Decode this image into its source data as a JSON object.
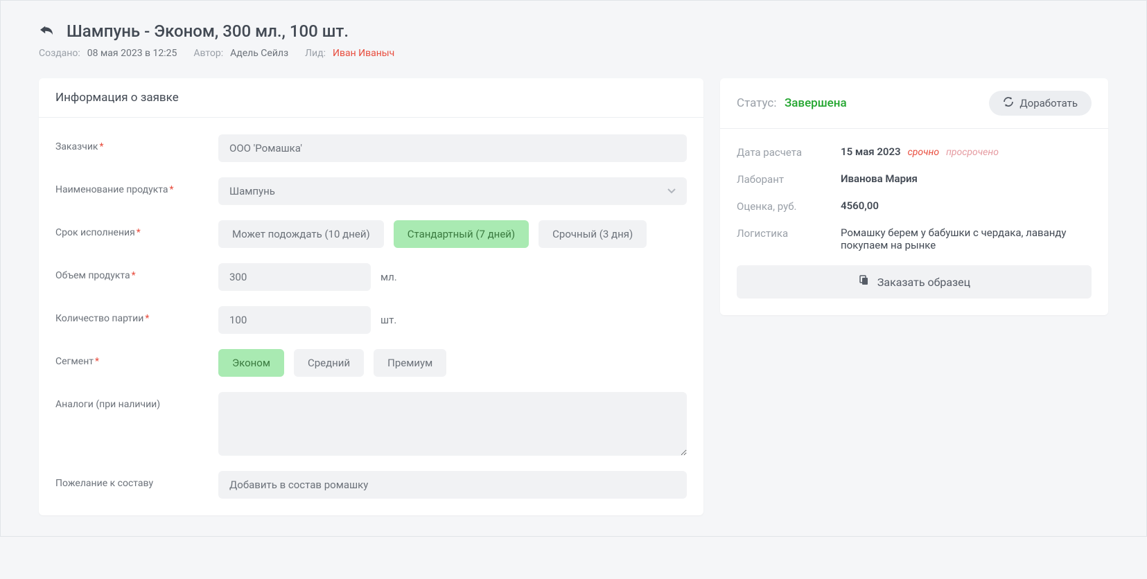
{
  "header": {
    "title": "Шампунь - Эконом, 300 мл., 100 шт.",
    "created_label": "Создано:",
    "created_value": "08 мая 2023 в 12:25",
    "author_label": "Автор:",
    "author_value": "Адель Сейлз",
    "lead_label": "Лид:",
    "lead_value": "Иван Иваныч"
  },
  "form_card": {
    "title": "Информация о заявке",
    "customer_label": "Заказчик",
    "customer_value": "ООО 'Ромашка'",
    "product_label": "Наименование продукта",
    "product_value": "Шампунь",
    "deadline_label": "Срок исполнения",
    "deadline_opts": {
      "wait": "Может подождать (10 дней)",
      "standard": "Стандартный (7 дней)",
      "urgent": "Срочный (3 дня)"
    },
    "volume_label": "Объем продукта",
    "volume_value": "300",
    "volume_unit": "мл.",
    "qty_label": "Количество партии",
    "qty_value": "100",
    "qty_unit": "шт.",
    "segment_label": "Сегмент",
    "segment_opts": {
      "econom": "Эконом",
      "mid": "Средний",
      "premium": "Премиум"
    },
    "analogs_label": "Аналоги (при наличии)",
    "analogs_value": "",
    "wish_label": "Пожелание к составу",
    "wish_value": "Добавить в состав ромашку"
  },
  "status_card": {
    "status_label": "Статус:",
    "status_value": "Завершена",
    "refine_label": "Доработать",
    "calc_date_label": "Дата расчета",
    "calc_date_value": "15 мая 2023",
    "tag_urgent": "срочно",
    "tag_overdue": "просрочено",
    "lab_label": "Лаборант",
    "lab_value": "Иванова Мария",
    "price_label": "Оценка, руб.",
    "price_value": "4560,00",
    "logistics_label": "Логистика",
    "logistics_value": "Ромашку берем у бабушки с чердака, лаванду покупаем на рынке",
    "order_sample_label": "Заказать образец"
  }
}
